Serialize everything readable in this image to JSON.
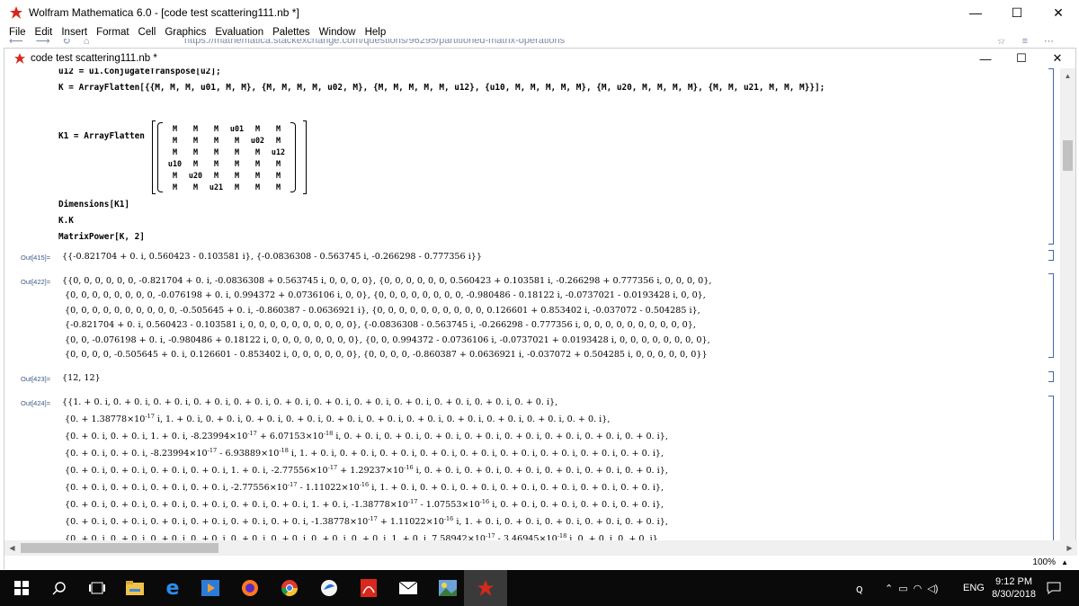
{
  "window": {
    "title": "Wolfram Mathematica 6.0 - [code test scattering111.nb *]",
    "controls": [
      "—",
      "☐",
      "✕"
    ]
  },
  "menu": [
    "File",
    "Edit",
    "Insert",
    "Format",
    "Cell",
    "Graphics",
    "Evaluation",
    "Palettes",
    "Window",
    "Help"
  ],
  "background_browser": {
    "url": "https://mathematica.stackexchange.com/questions/96295/partitioned-matrix-operations"
  },
  "notebook": {
    "title": "code test scattering111.nb *",
    "input": {
      "line_u12": "u12 = u1.ConjugateTranspose[u2];",
      "line_K": "K = ArrayFlatten[{{M, M, M, u01, M, M}, {M, M, M, M, u02, M}, {M, M, M, M, M, u12}, {u10, M, M, M, M, M}, {M, u20, M, M, M, M}, {M, M, u21, M, M, M}}];",
      "k1_prefix": "K1 = ArrayFlatten",
      "k1_matrix": [
        [
          "M",
          "M",
          "M",
          "u01",
          "M",
          "M"
        ],
        [
          "M",
          "M",
          "M",
          "M",
          "u02",
          "M"
        ],
        [
          "M",
          "M",
          "M",
          "M",
          "M",
          "u12"
        ],
        [
          "u10",
          "M",
          "M",
          "M",
          "M",
          "M"
        ],
        [
          "M",
          "u20",
          "M",
          "M",
          "M",
          "M"
        ],
        [
          "M",
          "M",
          "u21",
          "M",
          "M",
          "M"
        ]
      ],
      "line_dims": "Dimensions[K1]",
      "line_kk": "K.K",
      "line_power": "MatrixPower[K, 2]"
    },
    "outputs": [
      {
        "label": "Out[415]=",
        "lines": [
          "{{-0.821704 + 0. i, 0.560423 - 0.103581 i}, {-0.0836308 - 0.563745 i, -0.266298 - 0.777356 i}}"
        ]
      },
      {
        "label": "Out[422]=",
        "lines": [
          "{{0, 0, 0, 0, 0, 0, -0.821704 + 0. i, -0.0836308 + 0.563745 i, 0, 0, 0, 0}, {0, 0, 0, 0, 0, 0, 0.560423 + 0.103581 i, -0.266298 + 0.777356 i, 0, 0, 0, 0},",
          " {0, 0, 0, 0, 0, 0, 0, 0, -0.076198 + 0. i, 0.994372 + 0.0736106 i, 0, 0}, {0, 0, 0, 0, 0, 0, 0, 0, -0.980486 - 0.18122 i, -0.0737021 - 0.0193428 i, 0, 0},",
          " {0, 0, 0, 0, 0, 0, 0, 0, 0, 0, -0.505645 + 0. i, -0.860387 - 0.0636921 i}, {0, 0, 0, 0, 0, 0, 0, 0, 0, 0, 0.126601 + 0.853402 i, -0.037072 - 0.504285 i},",
          " {-0.821704 + 0. i, 0.560423 - 0.103581 i, 0, 0, 0, 0, 0, 0, 0, 0, 0, 0}, {-0.0836308 - 0.563745 i, -0.266298 - 0.777356 i, 0, 0, 0, 0, 0, 0, 0, 0, 0, 0},",
          " {0, 0, -0.076198 + 0. i, -0.980486 + 0.18122 i, 0, 0, 0, 0, 0, 0, 0, 0}, {0, 0, 0.994372 - 0.0736106 i, -0.0737021 + 0.0193428 i, 0, 0, 0, 0, 0, 0, 0, 0},",
          " {0, 0, 0, 0, -0.505645 + 0. i, 0.126601 - 0.853402 i, 0, 0, 0, 0, 0, 0}, {0, 0, 0, 0, -0.860387 + 0.0636921 i, -0.037072 + 0.504285 i, 0, 0, 0, 0, 0, 0}}"
        ]
      },
      {
        "label": "Out[423]=",
        "lines": [
          "{12, 12}"
        ]
      },
      {
        "label": "Out[424]=",
        "lines": [
          "{{1. + 0. i, 0. + 0. i, 0. + 0. i, 0. + 0. i, 0. + 0. i, 0. + 0. i, 0. + 0. i, 0. + 0. i, 0. + 0. i, 0. + 0. i, 0. + 0. i, 0. + 0. i},",
          " {0. + 1.38778×10^-17 i, 1. + 0. i, 0. + 0. i, 0. + 0. i, 0. + 0. i, 0. + 0. i, 0. + 0. i, 0. + 0. i, 0. + 0. i, 0. + 0. i, 0. + 0. i, 0. + 0. i},",
          " {0. + 0. i, 0. + 0. i, 1. + 0. i, -8.23994×10^-17 + 6.07153×10^-18 i, 0. + 0. i, 0. + 0. i, 0. + 0. i, 0. + 0. i, 0. + 0. i, 0. + 0. i, 0. + 0. i, 0. + 0. i},",
          " {0. + 0. i, 0. + 0. i, -8.23994×10^-17 - 6.93889×10^-18 i, 1. + 0. i, 0. + 0. i, 0. + 0. i, 0. + 0. i, 0. + 0. i, 0. + 0. i, 0. + 0. i, 0. + 0. i, 0. + 0. i},",
          " {0. + 0. i, 0. + 0. i, 0. + 0. i, 0. + 0. i, 1. + 0. i, -2.77556×10^-17 + 1.29237×10^-16 i, 0. + 0. i, 0. + 0. i, 0. + 0. i, 0. + 0. i, 0. + 0. i, 0. + 0. i},",
          " {0. + 0. i, 0. + 0. i, 0. + 0. i, 0. + 0. i, -2.77556×10^-17 - 1.11022×10^-16 i, 1. + 0. i, 0. + 0. i, 0. + 0. i, 0. + 0. i, 0. + 0. i, 0. + 0. i, 0. + 0. i},",
          " {0. + 0. i, 0. + 0. i, 0. + 0. i, 0. + 0. i, 0. + 0. i, 0. + 0. i, 1. + 0. i, -1.38778×10^-17 - 1.07553×10^-16 i, 0. + 0. i, 0. + 0. i, 0. + 0. i, 0. + 0. i},",
          " {0. + 0. i, 0. + 0. i, 0. + 0. i, 0. + 0. i, 0. + 0. i, 0. + 0. i, -1.38778×10^-17 + 1.11022×10^-16 i, 1. + 0. i, 0. + 0. i, 0. + 0. i, 0. + 0. i, 0. + 0. i},",
          " {0. + 0. i, 0. + 0. i, 0. + 0. i, 0. + 0. i, 0. + 0. i, 0. + 0. i, 0. + 0. i, 0. + 0. i, 1. + 0. i, 7.58942×10^-17 - 3.46945×10^-18 i, 0. + 0. i, 0. + 0. i}"
        ]
      }
    ],
    "zoom": "100%"
  },
  "taskbar": {
    "language": "ENG",
    "time": "9:12 PM",
    "date": "8/30/2018"
  },
  "colors": {
    "out_label": "#3d5a8a",
    "bracket": "#4466aa",
    "taskbar": "#0a0a0a"
  }
}
